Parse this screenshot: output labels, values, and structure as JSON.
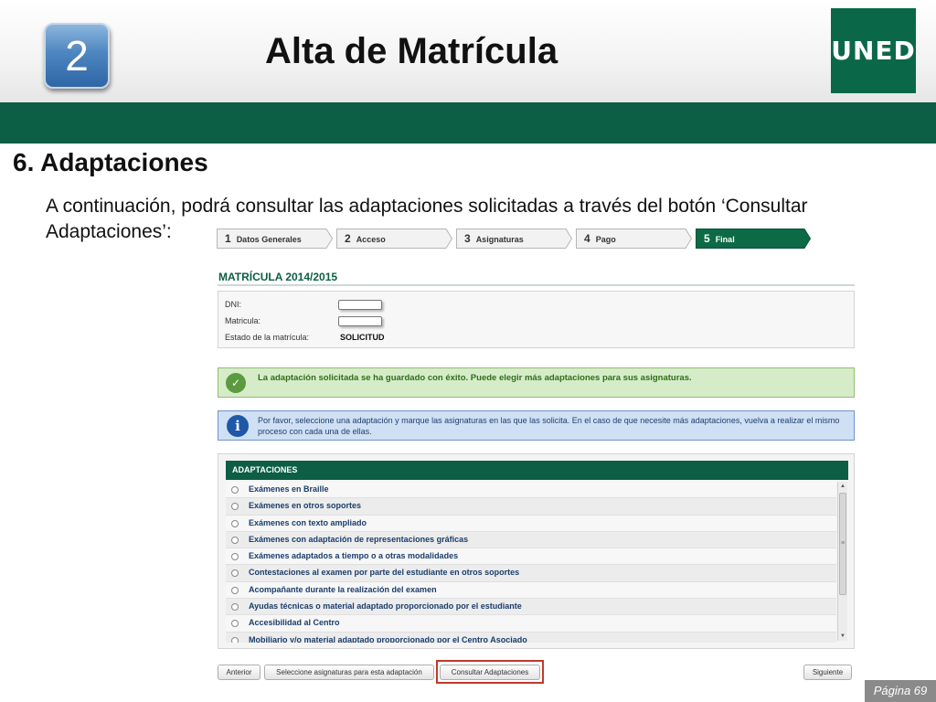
{
  "slide": {
    "step_number": "2",
    "title": "Alta de Matrícula",
    "logo_text": "UNED",
    "section_title": "6.  Adaptaciones",
    "intro_text": "A continuación, podrá consultar las adaptaciones solicitadas a través del botón ‘Consultar Adaptaciones’:",
    "page_label": "Página 69"
  },
  "wizard": {
    "steps": [
      {
        "num": "1",
        "label": "Datos Generales",
        "active": false
      },
      {
        "num": "2",
        "label": "Acceso",
        "active": false
      },
      {
        "num": "3",
        "label": "Asignaturas",
        "active": false
      },
      {
        "num": "4",
        "label": "Pago",
        "active": false
      },
      {
        "num": "5",
        "label": "Final",
        "active": true
      }
    ]
  },
  "form": {
    "title": "MATRÍCULA 2014/2015",
    "dni_label": "DNI:",
    "matricula_label": "Matricula:",
    "estado_label": "Estado de la matrícula:",
    "estado_value": "SOLICITUD"
  },
  "messages": {
    "success": "La adaptación solicitada se ha guardado con éxito. Puede elegir más adaptaciones para sus asignaturas.",
    "notice": "Por favor, seleccione una adaptación y marque las asignaturas en las que las solicita. En el caso de que necesite más adaptaciones, vuelva a realizar el mismo proceso con cada una de ellas."
  },
  "adaptaciones": {
    "header": "ADAPTACIONES",
    "items": [
      "Exámenes en Braille",
      "Exámenes en otros soportes",
      "Exámenes con texto ampliado",
      "Exámenes con adaptación de representaciones gráficas",
      "Exámenes adaptados a tiempo o a otras modalidades",
      "Contestaciones al examen por parte del estudiante en otros soportes",
      "Acompañante durante la realización del examen",
      "Ayudas técnicas o material adaptado proporcionado por el estudiante",
      "Accesibilidad al Centro",
      "Mobiliario y/o material adaptado proporcionado por el Centro Asociado"
    ]
  },
  "buttons": {
    "anterior": "Anterior",
    "seleccione": "Seleccione asignaturas para esta adaptación",
    "consultar": "Consultar Adaptaciones",
    "siguiente": "Siguiente"
  },
  "colors": {
    "brand_green": "#0c5e44",
    "badge_blue": "#4d86c0",
    "highlight_red": "#c0392b"
  }
}
